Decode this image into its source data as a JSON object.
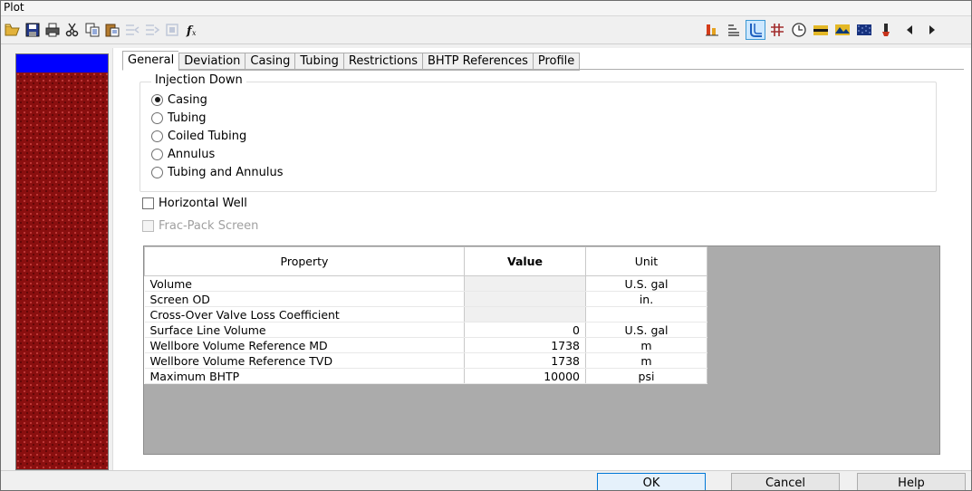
{
  "window": {
    "title": "Plot"
  },
  "toolbar": {
    "left": [
      "open-icon",
      "save-icon",
      "print-icon",
      "cut-icon",
      "copy-icon",
      "paste-icon",
      "insert-row-icon",
      "append-row-icon",
      "delete-row-icon",
      "function-icon"
    ],
    "right": [
      "bar-chart-icon",
      "align-icon",
      "wellbore-icon",
      "grid-icon",
      "clock-icon",
      "layer-icon",
      "terrain-icon",
      "pattern-icon",
      "tool-icon",
      "prev-icon",
      "next-icon"
    ]
  },
  "tabs": [
    "General",
    "Deviation",
    "Casing",
    "Tubing",
    "Restrictions",
    "BHTP References",
    "Profile"
  ],
  "active_tab": "General",
  "injection": {
    "group_title": "Injection Down",
    "options": [
      "Casing",
      "Tubing",
      "Coiled Tubing",
      "Annulus",
      "Tubing and Annulus"
    ],
    "selected": "Casing"
  },
  "checks": {
    "horizontal_well": "Horizontal Well",
    "frac_pack_screen": "Frac-Pack Screen"
  },
  "table": {
    "headers": {
      "property": "Property",
      "value": "Value",
      "unit": "Unit"
    },
    "rows": [
      {
        "property": "Volume",
        "value": "",
        "unit": "U.S. gal"
      },
      {
        "property": "Screen OD",
        "value": "",
        "unit": "in."
      },
      {
        "property": "Cross-Over Valve Loss Coefficient",
        "value": "",
        "unit": ""
      },
      {
        "property": "Surface Line Volume",
        "value": "0",
        "unit": "U.S. gal"
      },
      {
        "property": "Wellbore Volume Reference MD",
        "value": "1738",
        "unit": "m"
      },
      {
        "property": "Wellbore Volume Reference TVD",
        "value": "1738",
        "unit": "m"
      },
      {
        "property": "Maximum BHTP",
        "value": "10000",
        "unit": "psi"
      }
    ]
  },
  "buttons": {
    "ok": "OK",
    "cancel": "Cancel",
    "help": "Help"
  },
  "colors": {
    "left_top": "#0000ff",
    "left_body": "#8a0f0f"
  }
}
